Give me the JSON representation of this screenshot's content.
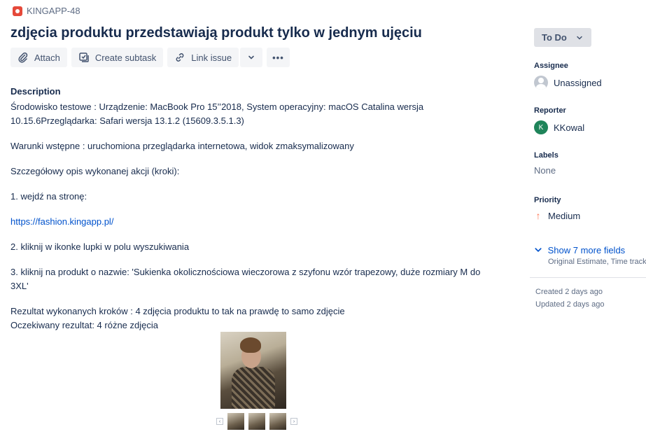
{
  "issue": {
    "key": "KINGAPP-48",
    "title": "zdjęcia produktu przedstawiają produkt tylko w jednym ujęciu"
  },
  "toolbar": {
    "attach_label": "Attach",
    "create_subtask_label": "Create subtask",
    "link_issue_label": "Link issue",
    "more_label": "•••"
  },
  "description": {
    "heading": "Description",
    "environment": "Środowisko testowe : Urządzenie: MacBook Pro 15’’2018, System operacyjny: macOS Catalina wersja 10.15.6Przeglądarka: Safari wersja 13.1.2 (15609.3.5.1.3)",
    "preconditions": "Warunki wstępne : uruchomiona przeglądarka internetowa, widok zmaksymalizowany",
    "steps_heading": "Szczegółowy opis wykonanej akcji (kroki):",
    "step1": "1. wejdź na stronę:",
    "link": "https://fashion.kingapp.pl/",
    "step2": "2. kliknij w ikonke lupki w polu wyszukiwania",
    "step3": "3. kliknij na produkt o nazwie: 'Sukienka okolicznościowa wieczorowa z szyfonu wzór trapezowy, duże rozmiary M do 3XL'",
    "result": "Rezultat wykonanych kroków : 4 zdjęcia produktu to tak na prawdę to samo zdjęcie",
    "expected": "Oczekiwany rezultat: 4 różne zdjęcia"
  },
  "attachment": {
    "prev": "‹",
    "next": "›"
  },
  "sidebar": {
    "status": "To Do",
    "assignee_label": "Assignee",
    "assignee_value": "Unassigned",
    "reporter_label": "Reporter",
    "reporter_initial": "K",
    "reporter_value": "KKowal",
    "labels_label": "Labels",
    "labels_value": "None",
    "priority_label": "Priority",
    "priority_value": "Medium",
    "more_fields": "Show 7 more fields",
    "more_fields_sub": "Original Estimate, Time track",
    "created": "Created 2 days ago",
    "updated": "Updated 2 days ago"
  },
  "colors": {
    "link": "#0052cc",
    "bug_icon": "#e5493a",
    "priority_medium": "#ff7452",
    "reporter_avatar": "#1f845a"
  },
  "icons": [
    "bug-icon",
    "paperclip-icon",
    "subtask-icon",
    "link-icon",
    "chevron-down-icon",
    "more-icon",
    "user-icon",
    "arrow-up-icon"
  ]
}
